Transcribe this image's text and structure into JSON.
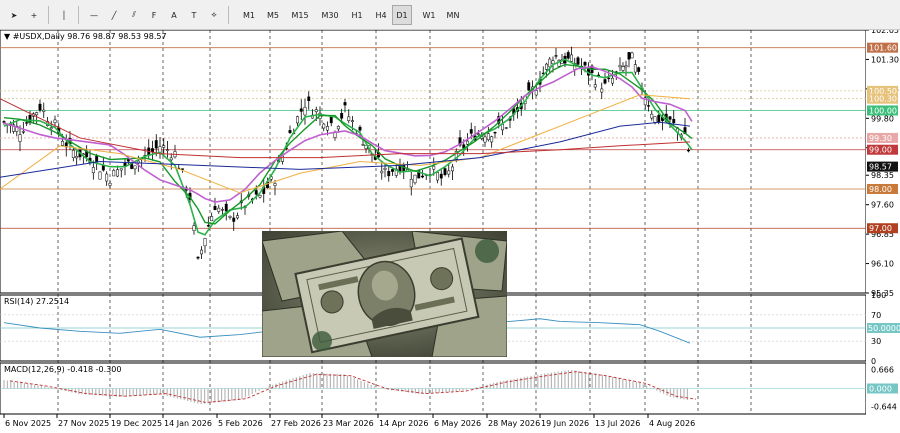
{
  "toolbar": {
    "tools": [
      {
        "name": "cursor-icon",
        "glyph": "➤"
      },
      {
        "name": "crosshair-icon",
        "glyph": "+"
      },
      {
        "name": "vertical-line-icon",
        "glyph": "│"
      },
      {
        "name": "horizontal-line-icon",
        "glyph": "—"
      },
      {
        "name": "trendline-icon",
        "glyph": "╱"
      },
      {
        "name": "channel-icon",
        "glyph": "⫽"
      },
      {
        "name": "fibonacci-icon",
        "glyph": "F"
      },
      {
        "name": "text-icon",
        "glyph": "A"
      },
      {
        "name": "label-icon",
        "glyph": "T"
      },
      {
        "name": "shapes-icon",
        "glyph": "⟡"
      }
    ],
    "timeframes": [
      "M1",
      "M5",
      "M15",
      "M30",
      "H1",
      "H4",
      "D1",
      "W1",
      "MN"
    ],
    "active_timeframe": "D1"
  },
  "chart": {
    "header": "#USDX,Daily",
    "ohlc": "98.76 98.87 98.53 98.57",
    "price_axis": [
      "102.05",
      "101.30",
      "100.55",
      "99.80",
      "99.05",
      "98.35",
      "97.60",
      "96.85",
      "96.10",
      "95.35"
    ],
    "level_tags": [
      {
        "text": "101.60",
        "color": "#c0714a"
      },
      {
        "text": "100.50",
        "color": "#e6c27a"
      },
      {
        "text": "100.30",
        "color": "#e6c27a"
      },
      {
        "text": "100.00",
        "color": "#3cbf7a"
      },
      {
        "text": "99.30",
        "color": "#e8a8a8"
      },
      {
        "text": "99.00",
        "color": "#c0393b"
      },
      {
        "text": "98.57",
        "color": "#111111"
      },
      {
        "text": "98.00",
        "color": "#c87a3a"
      },
      {
        "text": "97.00",
        "color": "#b04020"
      }
    ],
    "dates": [
      "6 Nov 2025",
      "27 Nov 2025",
      "19 Dec 2025",
      "14 Jan 2026",
      "5 Feb 2026",
      "27 Feb 2026",
      "23 Mar 2026",
      "14 Apr 2026",
      "6 May 2026",
      "28 May 2026",
      "19 Jun 2026",
      "13 Jul 2026",
      "4 Aug 2026"
    ],
    "colors": {
      "ma_fast": "#2bb24a",
      "ma_mid": "#159a2a",
      "ma_slow": "#c060d0",
      "ma_orange": "#f0b040",
      "ma_blue": "#1a2a9a",
      "ma_red": "#c03030",
      "candle": "#000000"
    }
  },
  "rsi": {
    "label": "RSI(14) 27.2514",
    "axis": [
      "100",
      "70",
      "50",
      "30",
      "0"
    ],
    "level_tag": "50.0000",
    "color": "#3a90c0"
  },
  "macd": {
    "label": "MACD(12,26,9) -0.418 -0.300",
    "axis": [
      "0.666",
      "0.000",
      "-0.644"
    ],
    "zero_tag": "0.000",
    "signal_color": "#c03030"
  },
  "chart_data": {
    "type": "line",
    "title": "#USDX,Daily",
    "x": [
      "6 Nov 2025",
      "27 Nov 2025",
      "19 Dec 2025",
      "14 Jan 2026",
      "5 Feb 2026",
      "27 Feb 2026",
      "23 Mar 2026",
      "14 Apr 2026",
      "6 May 2026",
      "28 May 2026",
      "19 Jun 2026",
      "13 Jul 2026",
      "4 Aug 2026"
    ],
    "series": [
      {
        "values": [
          99.7,
          99.3,
          98.3,
          98.6,
          96.9,
          98.0,
          100.2,
          98.3,
          98.2,
          99.6,
          101.3,
          101.2,
          98.6
        ]
      }
    ],
    "ylim": [
      95.35,
      102.05
    ]
  }
}
